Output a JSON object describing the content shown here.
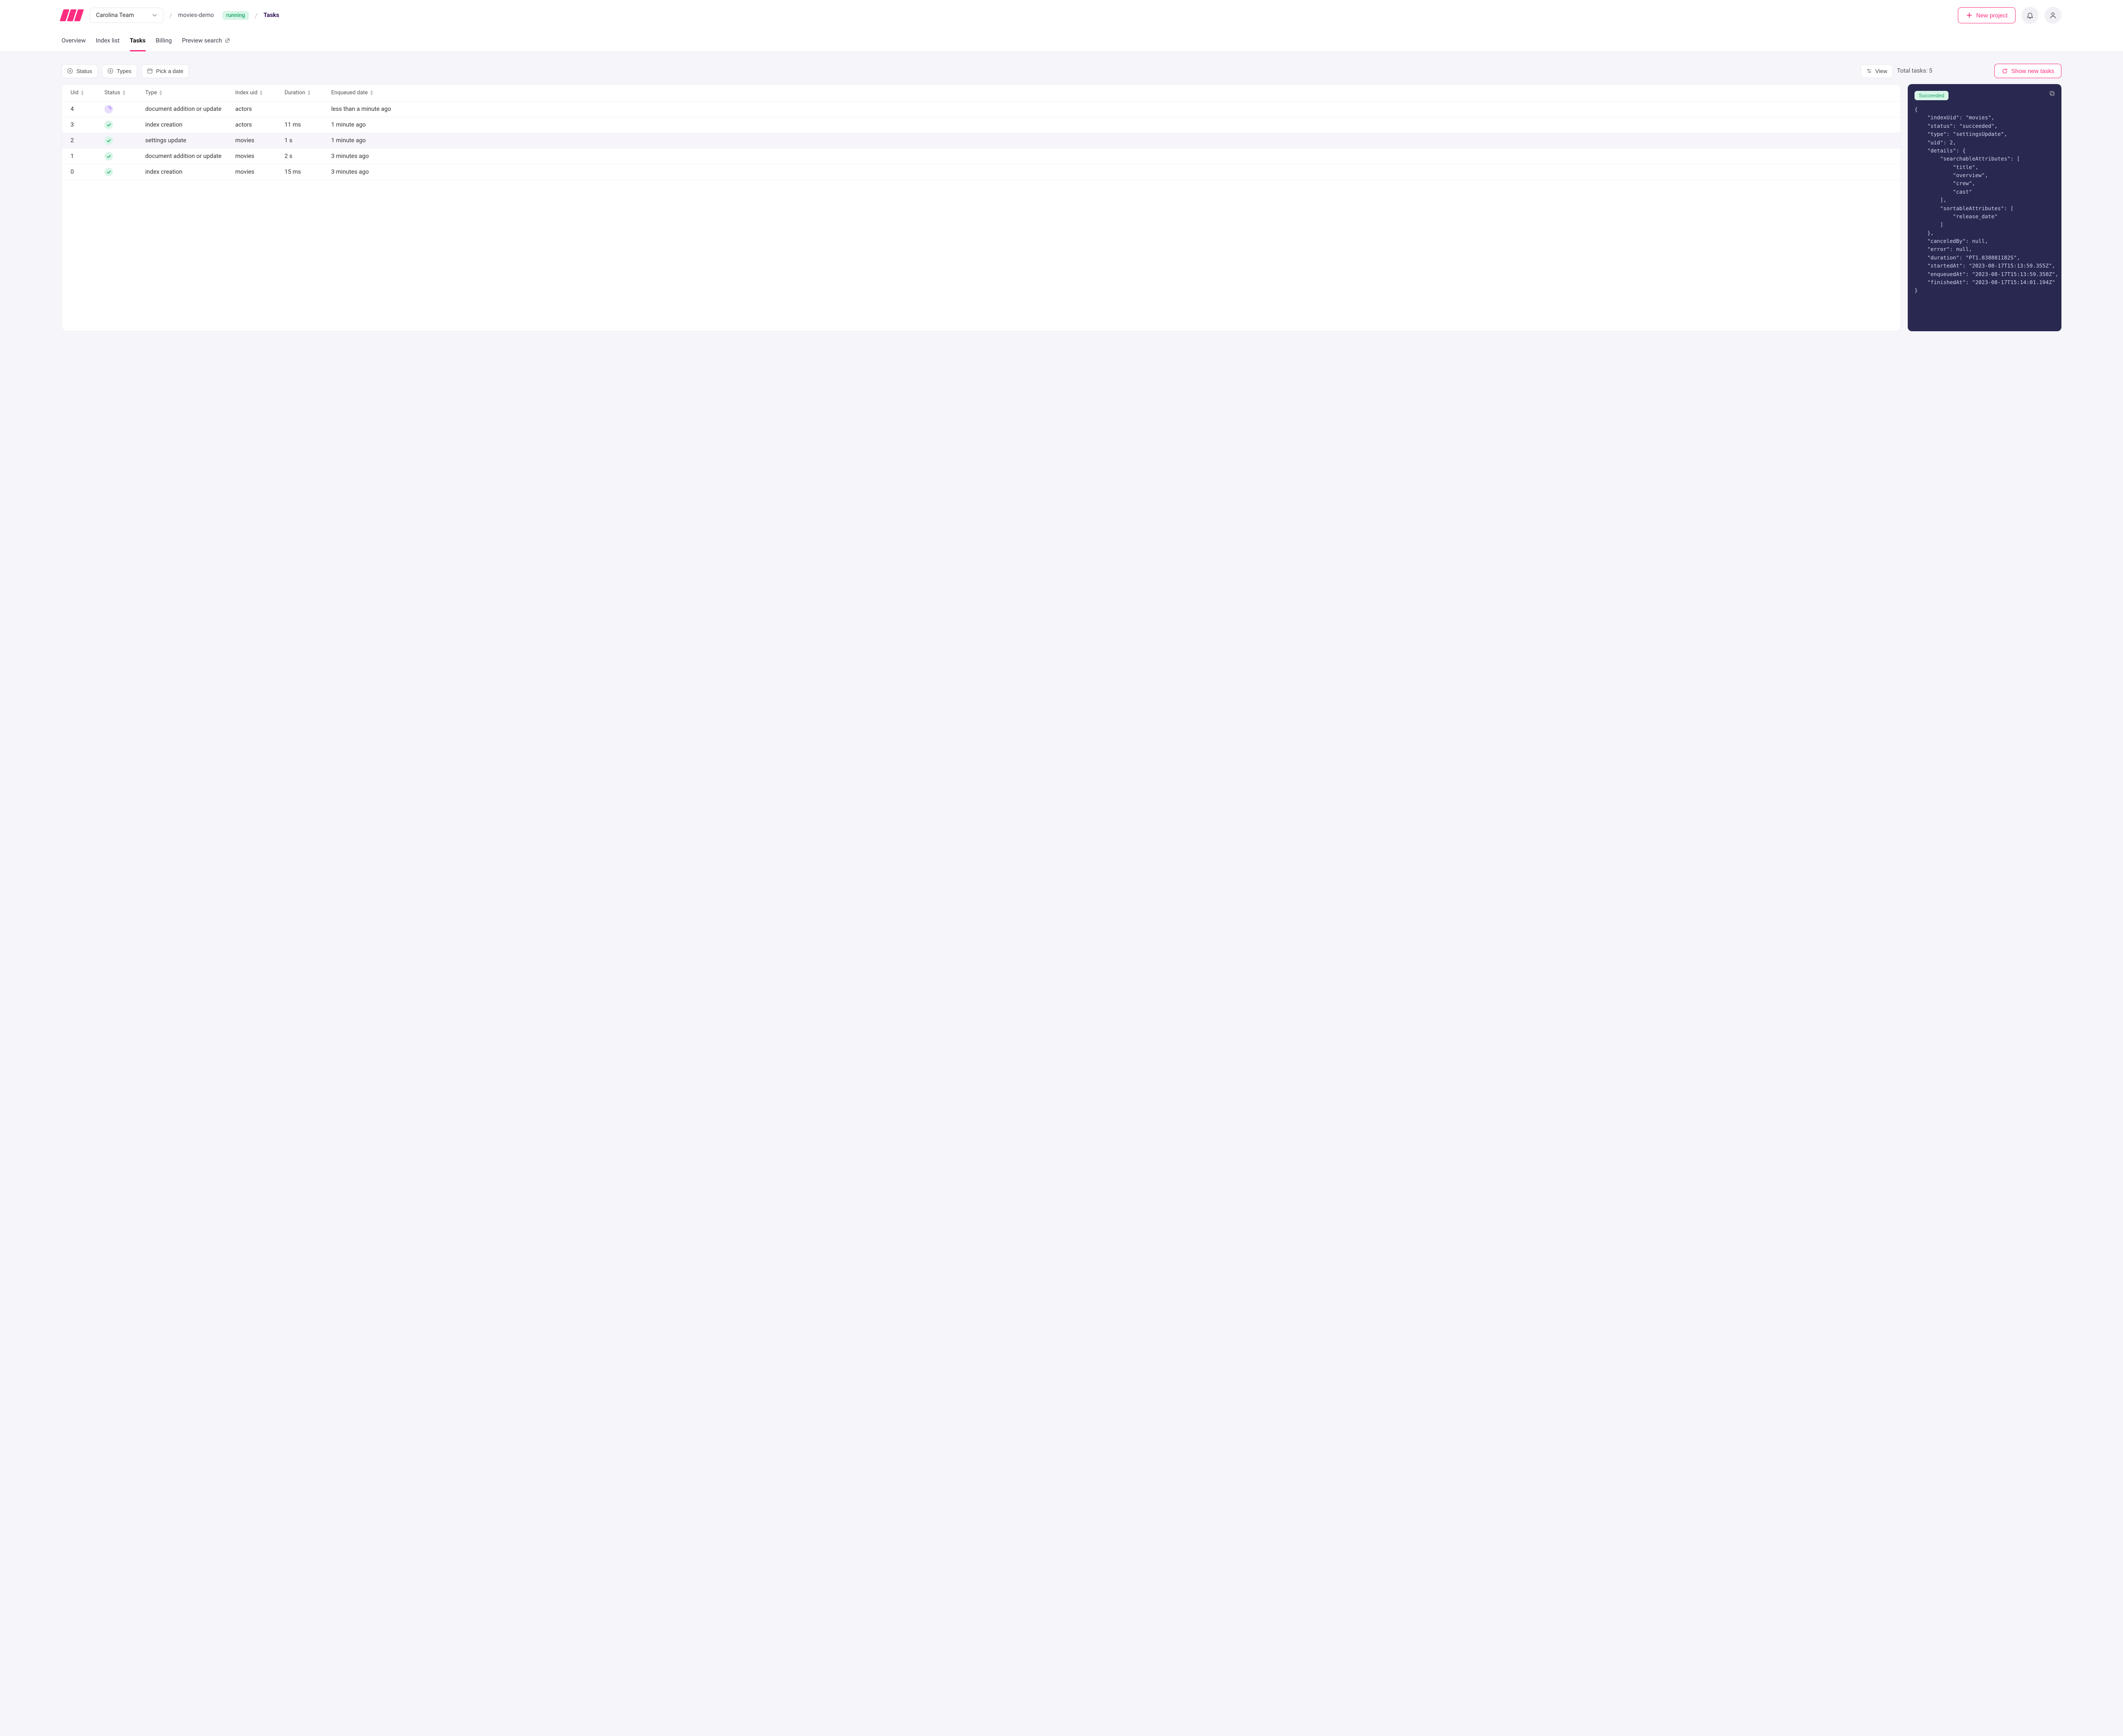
{
  "header": {
    "team": "Carolina Team",
    "project": "movies-demo",
    "status": "running",
    "crumb_current": "Tasks",
    "new_project_label": "New project"
  },
  "tabs": {
    "items": [
      {
        "label": "Overview",
        "active": false
      },
      {
        "label": "Index list",
        "active": false
      },
      {
        "label": "Tasks",
        "active": true
      },
      {
        "label": "Billing",
        "active": false
      },
      {
        "label": "Preview search",
        "active": false,
        "external": true
      }
    ]
  },
  "toolbar": {
    "status_label": "Status",
    "types_label": "Types",
    "date_label": "Pick a date",
    "view_label": "View",
    "total_tasks_label": "Total tasks: 5",
    "show_new_label": "Show new tasks"
  },
  "table": {
    "columns": [
      "Uid",
      "Status",
      "Type",
      "Index uid",
      "Duration",
      "Enqueued date"
    ],
    "rows": [
      {
        "uid": "4",
        "status": "processing",
        "type": "document addition or update",
        "index_uid": "actors",
        "duration": "",
        "enqueued": "less than a minute ago"
      },
      {
        "uid": "3",
        "status": "succeeded",
        "type": "index creation",
        "index_uid": "actors",
        "duration": "11 ms",
        "enqueued": "1 minute ago"
      },
      {
        "uid": "2",
        "status": "succeeded",
        "type": "settings update",
        "index_uid": "movies",
        "duration": "1 s",
        "enqueued": "1 minute ago",
        "selected": true
      },
      {
        "uid": "1",
        "status": "succeeded",
        "type": "document addition or update",
        "index_uid": "movies",
        "duration": "2 s",
        "enqueued": "3 minutes ago"
      },
      {
        "uid": "0",
        "status": "succeeded",
        "type": "index creation",
        "index_uid": "movies",
        "duration": "15 ms",
        "enqueued": "3 minutes ago"
      }
    ]
  },
  "detail": {
    "badge": "Succeeded",
    "json_text": "{\n    \"indexUid\": \"movies\",\n    \"status\": \"succeeded\",\n    \"type\": \"settingsUpdate\",\n    \"uid\": 2,\n    \"details\": {\n        \"searchableAttributes\": [\n            \"title\",\n            \"overview\",\n            \"crew\",\n            \"cast\"\n        ],\n        \"sortableAttributes\": [\n            \"release_date\"\n        ]\n    },\n    \"canceledBy\": null,\n    \"error\": null,\n    \"duration\": \"PT1.838881182S\",\n    \"startedAt\": \"2023-08-17T15:13:59.355Z\",\n    \"enqueuedAt\": \"2023-08-17T15:13:59.350Z\",\n    \"finishedAt\": \"2023-08-17T15:14:01.194Z\"\n}"
  }
}
